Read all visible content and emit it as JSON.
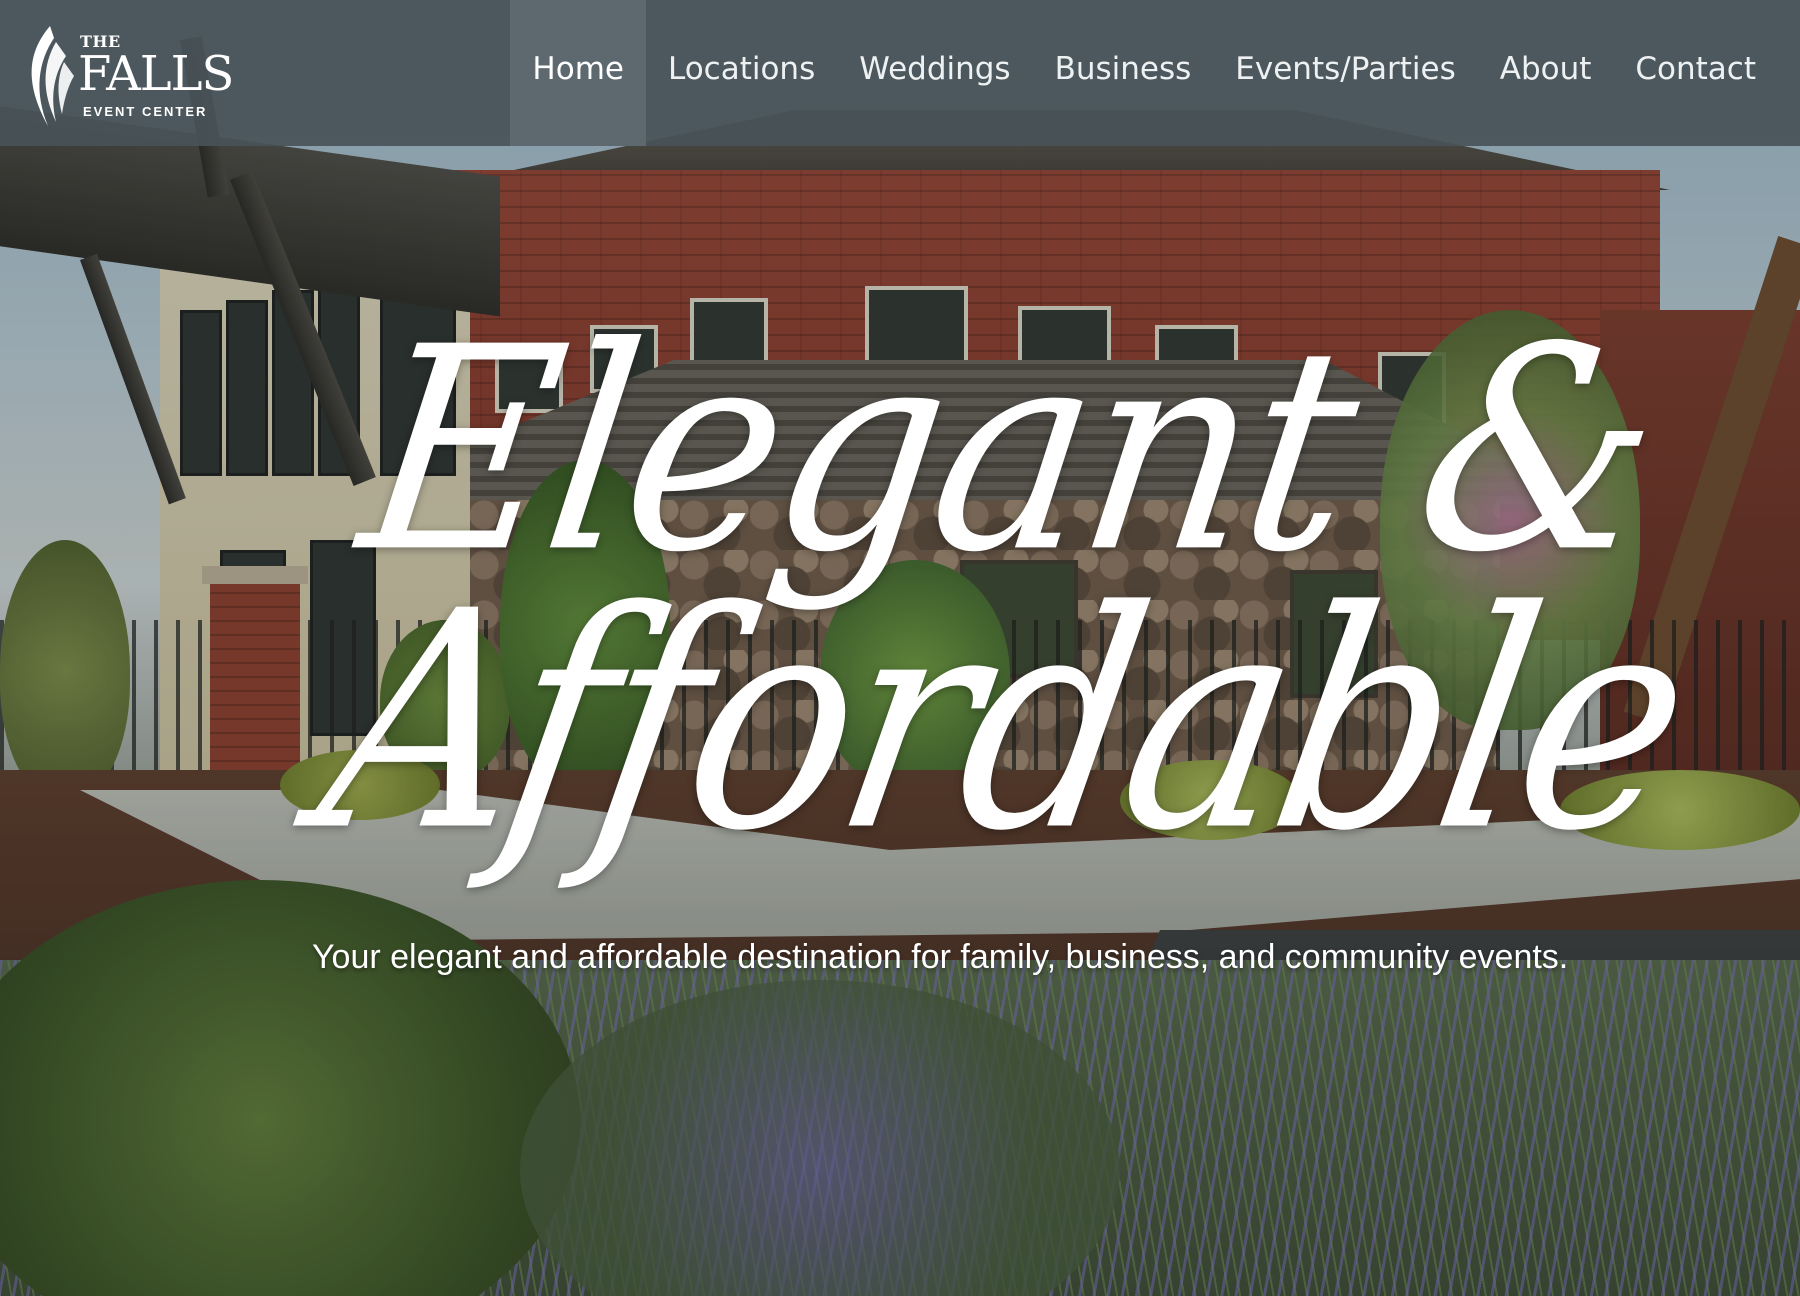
{
  "brand": {
    "logo_the": "THE",
    "logo_name": "FALLS",
    "logo_subtitle": "EVENT CENTER",
    "logo_icon": "flame-swoosh-icon"
  },
  "nav": {
    "items": [
      {
        "label": "Home",
        "active": true
      },
      {
        "label": "Locations",
        "active": false
      },
      {
        "label": "Weddings",
        "active": false
      },
      {
        "label": "Business",
        "active": false
      },
      {
        "label": "Events/Parties",
        "active": false
      },
      {
        "label": "About",
        "active": false
      },
      {
        "label": "Contact",
        "active": false
      }
    ]
  },
  "hero": {
    "headline_line1": "Elegant &",
    "headline_line2": "Affordable",
    "tagline": "Your elegant and affordable destination for family, business, and community events."
  },
  "colors": {
    "navbar_bg": "#485258",
    "nav_active_bg": "#5f6a70",
    "text": "#ffffff"
  }
}
